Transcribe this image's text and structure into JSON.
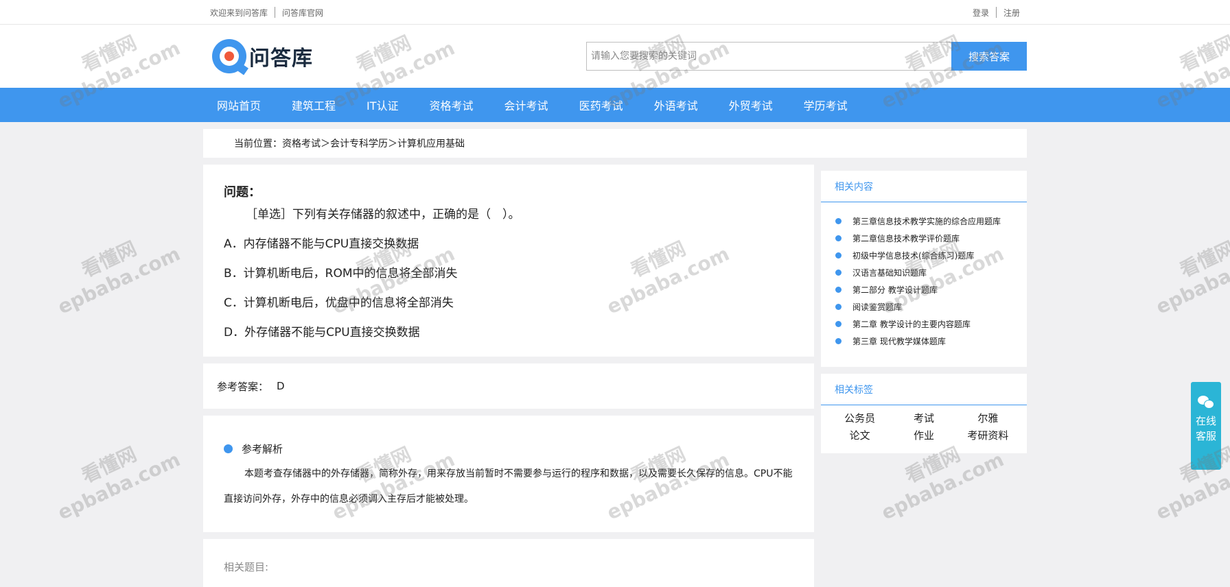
{
  "topbar": {
    "welcome": "欢迎来到问答库",
    "official_site": "问答库官网",
    "login": "登录",
    "register": "注册"
  },
  "logo": {
    "text": "问答库"
  },
  "search": {
    "placeholder": "请输入您要搜索的关键词",
    "button": "搜索答案"
  },
  "nav": {
    "items": [
      "网站首页",
      "建筑工程",
      "IT认证",
      "资格考试",
      "会计考试",
      "医药考试",
      "外语考试",
      "外贸考试",
      "学历考试"
    ]
  },
  "breadcrumb": {
    "text": "当前位置：资格考试＞会计专科学历＞计算机应用基础"
  },
  "question": {
    "title": "问题：",
    "stem": "［单选］下列有关存储器的叙述中，正确的是（　）。",
    "options": [
      "A．内存储器不能与CPU直接交换数据",
      "B．计算机断电后，ROM中的信息将全部消失",
      "C．计算机断电后，优盘中的信息将全部消失",
      "D．外存储器不能与CPU直接交换数据"
    ]
  },
  "answer": {
    "label": "参考答案：",
    "value": "D"
  },
  "analysis": {
    "title": "参考解析",
    "text": "本题考查存储器中的外存储器，简称外存，用来存放当前暂时不需要参与运行的程序和数据，以及需要长久保存的信息。CPU不能直接访问外存，外存中的信息必须调入主存后才能被处理。"
  },
  "related_questions": {
    "title": "相关题目:"
  },
  "related_content": {
    "title": "相关内容",
    "items": [
      "第三章信息技术教学实施的综合应用题库",
      "第二章信息技术教学评价题库",
      "初级中学信息技术(综合练习)题库",
      "汉语言基础知识题库",
      "第二部分 教学设计题库",
      "阅读鉴赏题库",
      "第二章 教学设计的主要内容题库",
      "第三章 现代教学媒体题库"
    ]
  },
  "related_tags": {
    "title": "相关标签",
    "items": [
      "公务员",
      "考试",
      "尔雅",
      "论文",
      "作业",
      "考研资料"
    ]
  },
  "service": {
    "line1": "在线",
    "line2": "客服",
    "icon": "wechat-icon"
  },
  "watermark": {
    "line1": "看懂网",
    "line2": "epbaba.com"
  },
  "colors": {
    "accent": "#3f96ee",
    "service": "#2bb5d6",
    "logo_dot": "#f05a3c"
  }
}
